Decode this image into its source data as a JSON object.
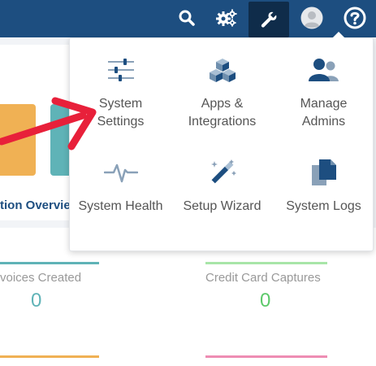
{
  "topbar": {
    "icons": [
      "search-icon",
      "gears-icon",
      "wrench-icon",
      "avatar-icon",
      "help-icon"
    ],
    "color": "#1d4e80",
    "active_color": "#0f2c4a"
  },
  "background": {
    "section_title": "tion Overvie",
    "stats": [
      {
        "label": "voices Created",
        "value": "0",
        "color": "#5fb3b7"
      },
      {
        "label": "Credit Card Captures",
        "value": "0",
        "color": "#5cc96a"
      }
    ],
    "tile_colors": [
      "#f0b154",
      "#5fb3b7"
    ]
  },
  "menu": {
    "items": [
      {
        "label": "System Settings",
        "icon": "sliders-icon"
      },
      {
        "label": "Apps & Integrations",
        "icon": "cubes-icon"
      },
      {
        "label": "Manage Admins",
        "icon": "users-icon"
      },
      {
        "label": "System Health",
        "icon": "heartbeat-icon"
      },
      {
        "label": "Setup Wizard",
        "icon": "magic-wand-icon"
      },
      {
        "label": "System Logs",
        "icon": "copy-files-icon"
      }
    ]
  },
  "annotation": {
    "color": "#e8203a"
  }
}
